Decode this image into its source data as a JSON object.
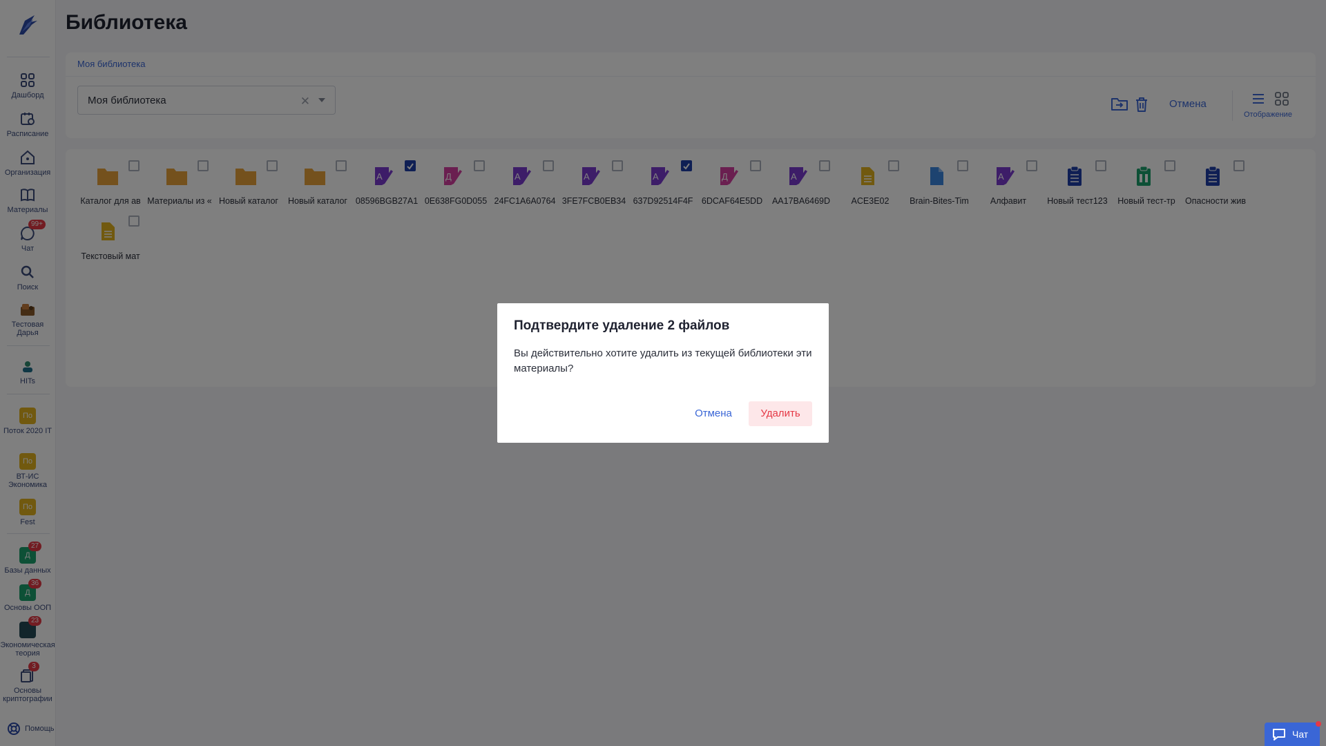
{
  "app": {
    "title": "Библиотека"
  },
  "sidebar": {
    "items": [
      {
        "label": "Дашборд",
        "icon": "dashboard-icon"
      },
      {
        "label": "Расписание",
        "icon": "calendar-icon"
      },
      {
        "label": "Организация",
        "icon": "home-icon"
      },
      {
        "label": "Материалы",
        "icon": "book-icon"
      },
      {
        "label": "Чат",
        "icon": "chat-icon",
        "badge": "99+"
      },
      {
        "label": "Поиск",
        "icon": "search-icon"
      },
      {
        "label": "Тестовая Дарья",
        "icon": "avatar-image"
      },
      {
        "label": "HITs",
        "icon": "avatar-image"
      }
    ],
    "courses": [
      {
        "label": "Поток 2020 IT",
        "avatar": "По",
        "color": "#e2b21f"
      },
      {
        "label": "ВТ-ИС Экономика",
        "avatar": "По",
        "color": "#e2b21f"
      },
      {
        "label": "Fest",
        "avatar": "По",
        "color": "#e2b21f"
      },
      {
        "label": "Базы данных",
        "avatar": "Д",
        "color": "#1aa06d",
        "badge": "27"
      },
      {
        "label": "Основы ООП",
        "avatar": "Д",
        "color": "#1aa06d",
        "badge": "36"
      },
      {
        "label": "Экономическая теория",
        "avatar": "",
        "color": "#244b57",
        "badge": "23"
      },
      {
        "label": "Основы криптографии",
        "avatar": "",
        "color": "#ffffff",
        "badge": "3"
      }
    ],
    "help": "Помощь"
  },
  "breadcrumb": "Моя библиотека",
  "library_select": {
    "value": "Моя библиотека"
  },
  "toolbar": {
    "cancel": "Отмена",
    "view_label": "Отображение"
  },
  "files": [
    {
      "name": "Каталог для ав",
      "type": "folder",
      "checked": false
    },
    {
      "name": "Материалы из «",
      "type": "folder",
      "checked": false
    },
    {
      "name": "Новый каталог",
      "type": "folder",
      "checked": false
    },
    {
      "name": "Новый каталог",
      "type": "folder",
      "checked": false
    },
    {
      "name": "08596BGB27A1",
      "type": "quiz",
      "checked": true
    },
    {
      "name": "0E638FG0D055",
      "type": "quiz-pink",
      "checked": false
    },
    {
      "name": "24FC1A6A0764",
      "type": "quiz",
      "checked": false
    },
    {
      "name": "3FE7FCB0EB34",
      "type": "quiz",
      "checked": false
    },
    {
      "name": "637D92514F4F",
      "type": "quiz",
      "checked": true
    },
    {
      "name": "6DCAF64E5DD",
      "type": "quiz-pink",
      "checked": false
    },
    {
      "name": "AA17BA6469D",
      "type": "quiz",
      "checked": false
    },
    {
      "name": "ACE3E02",
      "type": "doc-yellow",
      "checked": false
    },
    {
      "name": "Brain-Bites-Tim",
      "type": "doc-blue",
      "checked": false
    },
    {
      "name": "Алфавит",
      "type": "quiz",
      "checked": false
    },
    {
      "name": "Новый тест123",
      "type": "test-blue",
      "checked": false
    },
    {
      "name": "Новый тест-тр",
      "type": "test-green",
      "checked": false
    },
    {
      "name": "Опасности жив",
      "type": "test-blue",
      "checked": false
    },
    {
      "name": "Текстовый мат",
      "type": "doc-yellow",
      "checked": false
    }
  ],
  "dialog": {
    "title": "Подтвердите удаление 2 файлов",
    "message": "Вы действительно хотите удалить из текущей библиотеки эти материалы?",
    "cancel": "Отмена",
    "confirm": "Удалить"
  },
  "chat_widget": {
    "label": "Чат"
  },
  "colors": {
    "accent": "#3a66d6",
    "danger": "#e53845",
    "folder": "#e8a33b",
    "quiz": "#7a3bd0",
    "quiz_pink": "#d43fa0"
  }
}
